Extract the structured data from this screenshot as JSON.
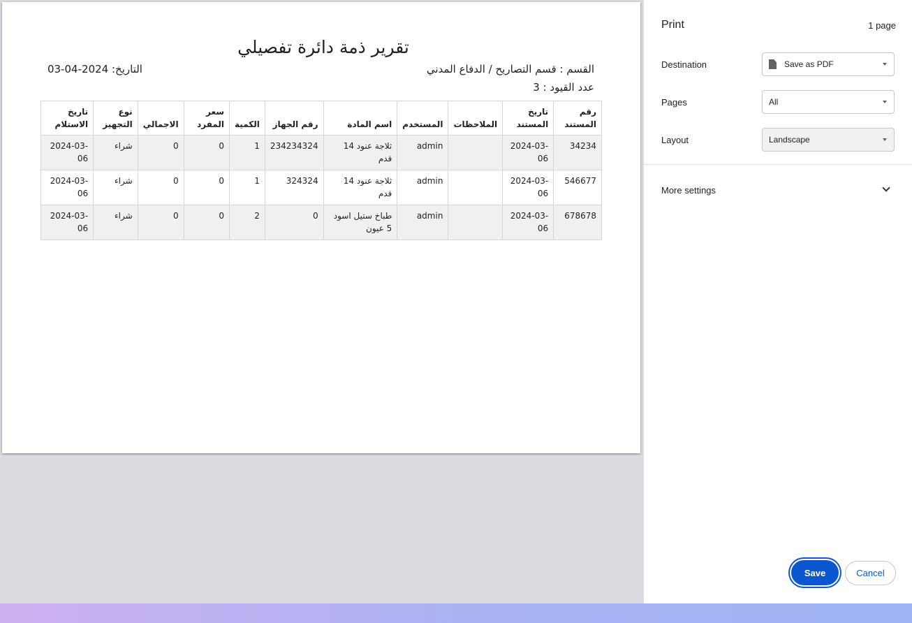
{
  "report": {
    "title": "تقرير ذمة دائرة تفصيلي",
    "date": "التاريخ: 2024-04-03",
    "department": "القسم : قسم التصاريح / الدفاع المدني",
    "record_count": "عدد القيود : 3",
    "columns": [
      "رقم المستند",
      "تاريخ المستند",
      "الملاحظات",
      "المستخدم",
      "اسم المادة",
      "رقم الجهاز",
      "الكمية",
      "سعر المفرد",
      "الاجمالي",
      "نوع التجهيز",
      "تاريخ الاستلام"
    ],
    "rows": [
      [
        "34234",
        "2024-03-06",
        "",
        "admin",
        "ثلاجة عنود 14 قدم",
        "234234324",
        "1",
        "0",
        "0",
        "شراء",
        "2024-03-06"
      ],
      [
        "546677",
        "2024-03-06",
        "",
        "admin",
        "ثلاجة عنود 14 قدم",
        "324324",
        "1",
        "0",
        "0",
        "شراء",
        "2024-03-06"
      ],
      [
        "678678",
        "2024-03-06",
        "",
        "admin",
        "طباخ ستيل اسود 5 عيون",
        "0",
        "2",
        "0",
        "0",
        "شراء",
        "2024-03-06"
      ]
    ]
  },
  "print_panel": {
    "title": "Print",
    "page_count": "1 page",
    "destination_label": "Destination",
    "destination_value": "Save as PDF",
    "destination_icon": "pdf-file-icon",
    "pages_label": "Pages",
    "pages_value": "All",
    "layout_label": "Layout",
    "layout_value": "Landscape",
    "more_settings_label": "More settings",
    "save_label": "Save",
    "cancel_label": "Cancel",
    "accent_color": "#0b57d0"
  }
}
